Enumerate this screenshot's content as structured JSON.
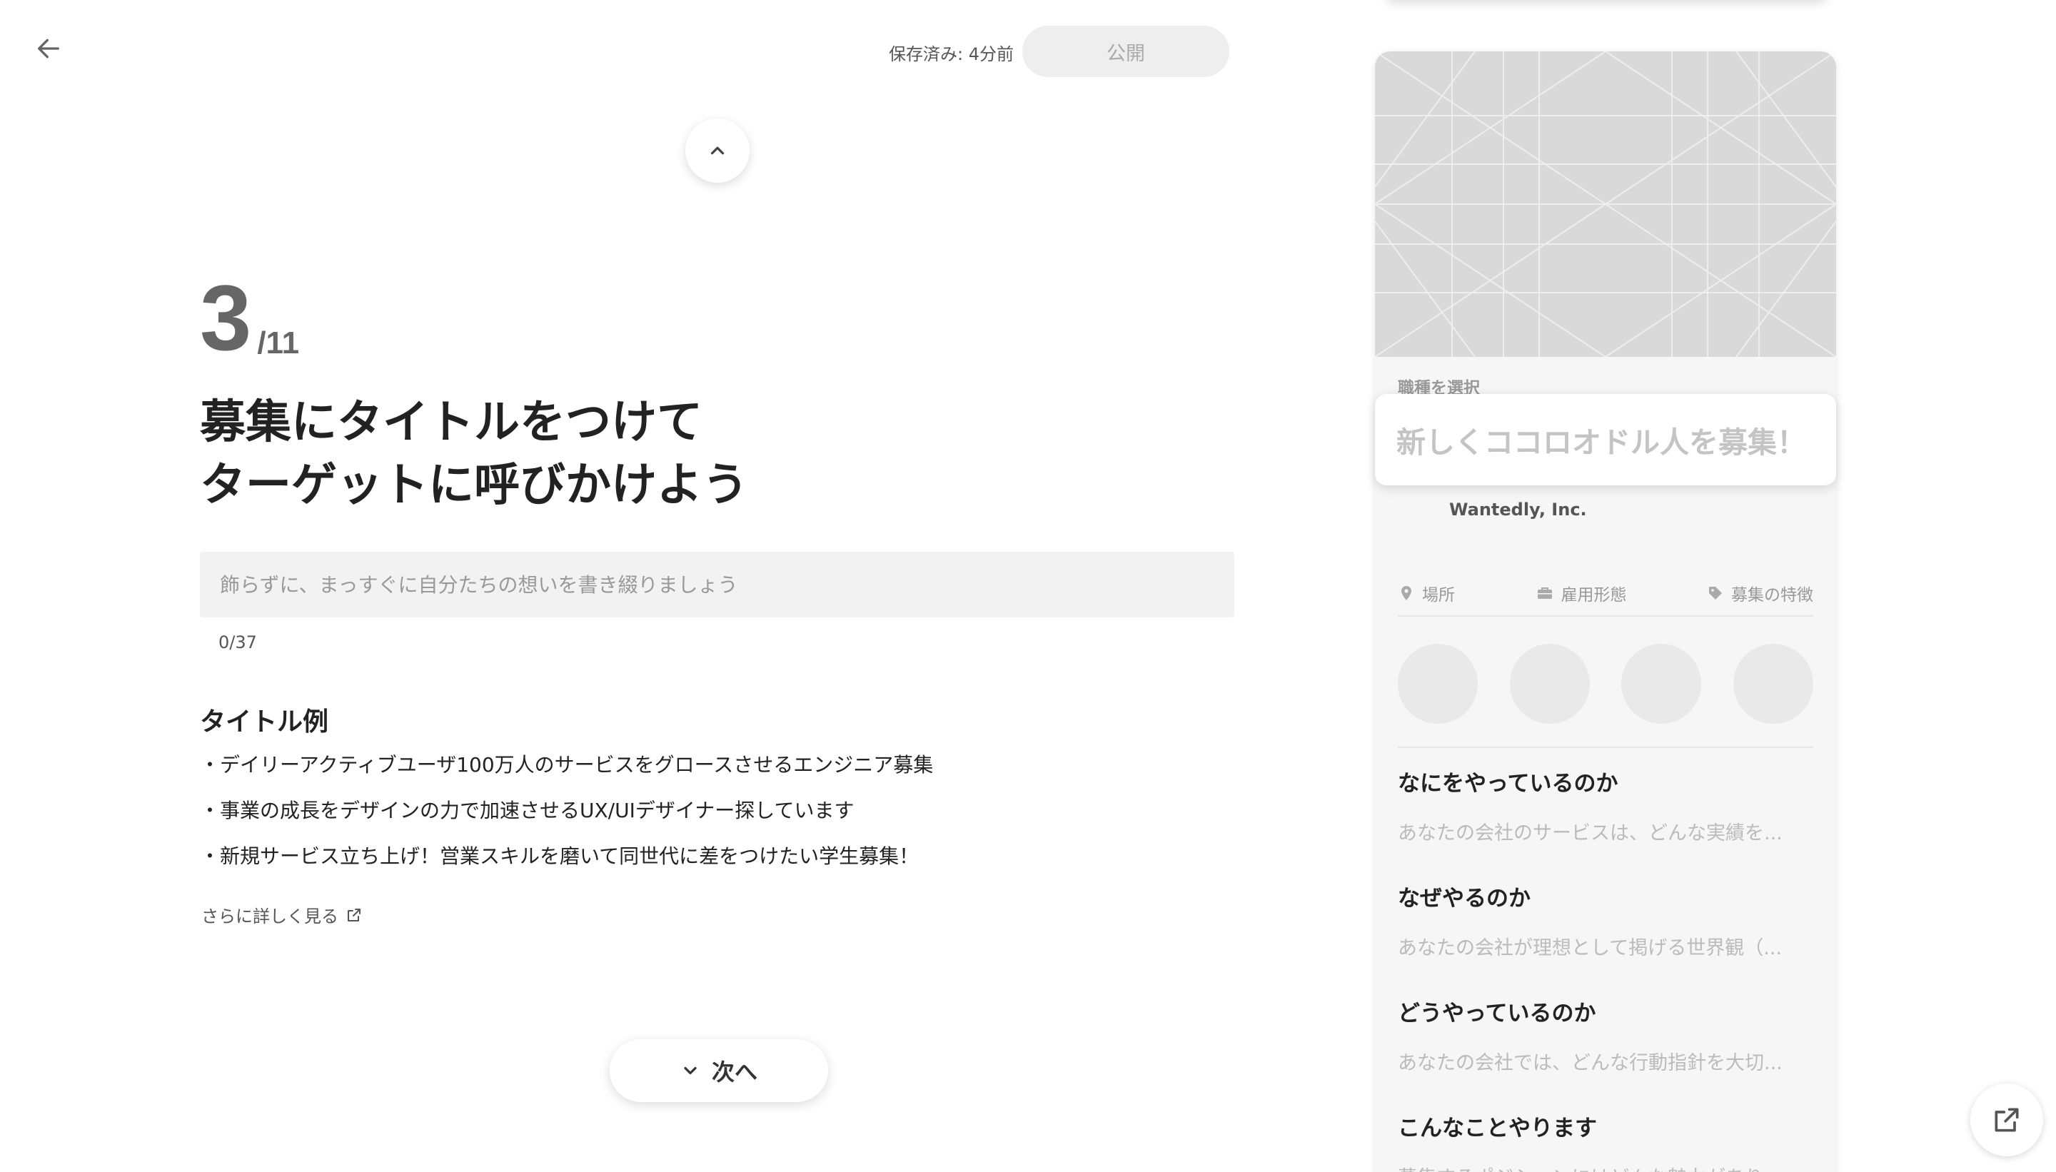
{
  "header": {
    "saved_status": "保存済み: 4分前",
    "publish_label": "公開"
  },
  "step": {
    "current": "3",
    "total": "/11"
  },
  "heading": {
    "line1": "募集にタイトルをつけて",
    "line2": "ターゲットに呼びかけよう"
  },
  "title_input": {
    "placeholder": "飾らずに、まっすぐに自分たちの想いを書き綴りましょう",
    "value": "",
    "counter": "0/37"
  },
  "examples": {
    "title": "タイトル例",
    "items": [
      "・デイリーアクティブユーザ100万人のサービスをグロースさせるエンジニア募集",
      "・事業の成長をデザインの力で加速させるUX/UIデザイナー探しています",
      "・新規サービス立ち上げ！営業スキルを磨いて同世代に差をつけたい学生募集！"
    ],
    "more_link": "さらに詳しく見る"
  },
  "next_label": "次へ",
  "preview": {
    "occupation": "職種を選択",
    "title": "新しくココロオドル人を募集！",
    "company": "Wantedly, Inc.",
    "meta": {
      "location": "場所",
      "employment": "雇用形態",
      "features": "募集の特徴"
    },
    "sections": [
      {
        "heading": "なにをやっているのか",
        "text": "あなたの会社のサービスは、どんな実績を..."
      },
      {
        "heading": "なぜやるのか",
        "text": "あなたの会社が理想として掲げる世界観（..."
      },
      {
        "heading": "どうやっているのか",
        "text": "あなたの会社では、どんな行動指針を大切..."
      },
      {
        "heading": "こんなことやります",
        "text": "募集するポジションにはどんな魅力があり..."
      }
    ]
  },
  "icons": {
    "back": "arrow-left-icon",
    "up": "chevron-up-icon",
    "next": "chevron-down-icon",
    "external": "external-link-icon",
    "location": "map-pin-icon",
    "employment": "briefcase-icon",
    "features": "tag-icon"
  },
  "colors": {
    "publish_bg": "#eeeeee",
    "input_bg": "#f2f2f2",
    "preview_bg": "#f6f6f6",
    "cover_bg": "#d9d9d9"
  }
}
